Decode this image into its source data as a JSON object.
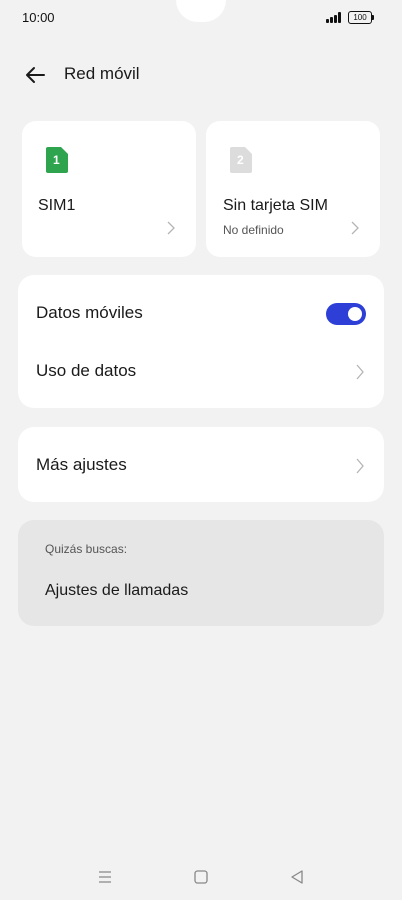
{
  "status_bar": {
    "time": "10:00",
    "battery": "100",
    "icons": [
      "signal-icon",
      "battery-icon"
    ]
  },
  "header": {
    "title": "Red móvil",
    "back_icon": "arrow-left-icon"
  },
  "sims": [
    {
      "badge": "1",
      "name": "SIM1",
      "sub": "",
      "badge_color": "#2ea44f"
    },
    {
      "badge": "2",
      "name": "Sin tarjeta SIM",
      "sub": "No definido",
      "badge_color": "#dcdcdc"
    }
  ],
  "data_group": {
    "mobile_data_label": "Datos móviles",
    "mobile_data_enabled": true,
    "data_usage_label": "Uso de datos"
  },
  "more_settings_label": "Más ajustes",
  "suggestions": {
    "caption": "Quizás buscas:",
    "item": "Ajustes de llamadas"
  },
  "navbar": {
    "icons": [
      "menu-icon",
      "home-icon",
      "back-icon"
    ]
  },
  "colors": {
    "accent": "#2d3fd6",
    "background": "#f2f2f2",
    "sim1": "#2ea44f"
  }
}
